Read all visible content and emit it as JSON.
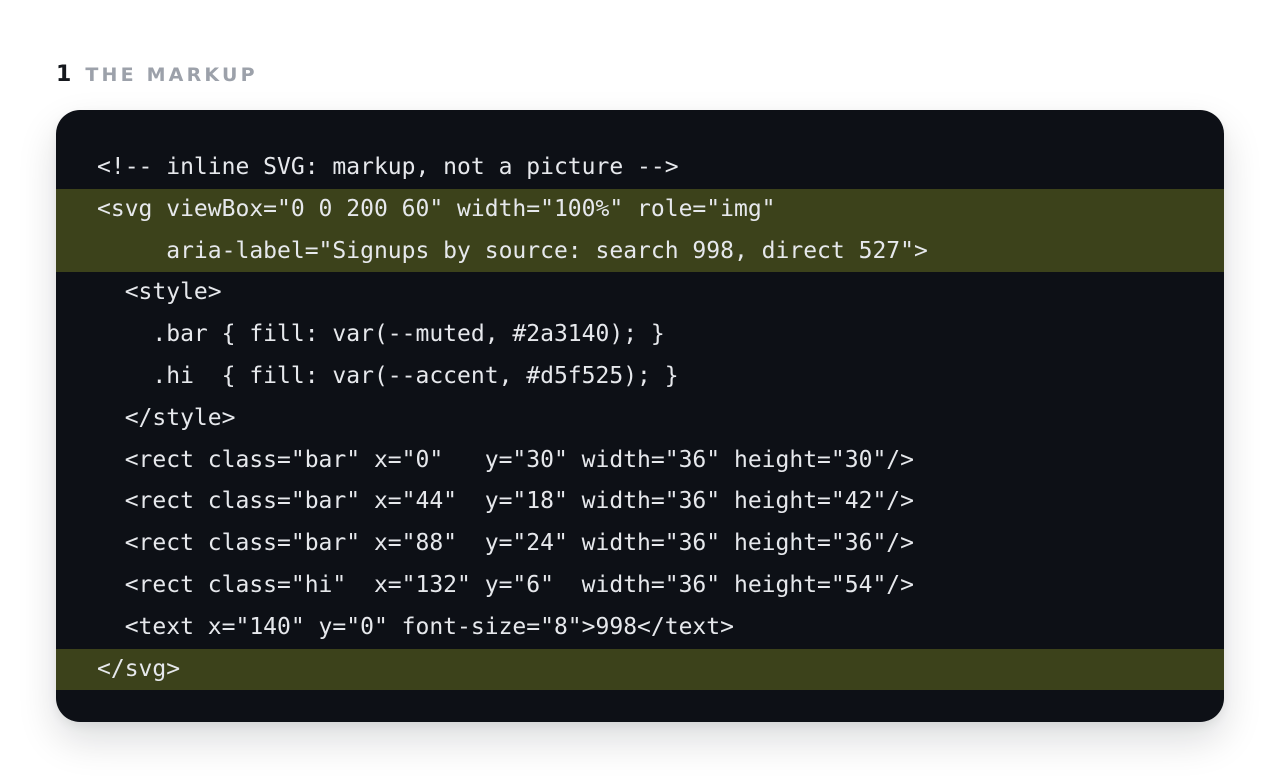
{
  "section": {
    "number": "1",
    "title": "THE MARKUP"
  },
  "code": {
    "lines": [
      {
        "text": "<!-- inline SVG: markup, not a picture -->",
        "highlighted": false
      },
      {
        "text": "<svg viewBox=\"0 0 200 60\" width=\"100%\" role=\"img\"",
        "highlighted": true
      },
      {
        "text": "     aria-label=\"Signups by source: search 998, direct 527\">",
        "highlighted": true
      },
      {
        "text": "  <style>",
        "highlighted": false
      },
      {
        "text": "    .bar { fill: var(--muted, #2a3140); }",
        "highlighted": false
      },
      {
        "text": "    .hi  { fill: var(--accent, #d5f525); }",
        "highlighted": false
      },
      {
        "text": "  </style>",
        "highlighted": false
      },
      {
        "text": "  <rect class=\"bar\" x=\"0\"   y=\"30\" width=\"36\" height=\"30\"/>",
        "highlighted": false
      },
      {
        "text": "  <rect class=\"bar\" x=\"44\"  y=\"18\" width=\"36\" height=\"42\"/>",
        "highlighted": false
      },
      {
        "text": "  <rect class=\"bar\" x=\"88\"  y=\"24\" width=\"36\" height=\"36\"/>",
        "highlighted": false
      },
      {
        "text": "  <rect class=\"hi\"  x=\"132\" y=\"6\"  width=\"36\" height=\"54\"/>",
        "highlighted": false
      },
      {
        "text": "  <text x=\"140\" y=\"0\" font-size=\"8\">998</text>",
        "highlighted": false
      },
      {
        "text": "</svg>",
        "highlighted": true
      }
    ]
  },
  "colors": {
    "card_background": "#0d1016",
    "highlight_background": "#3c421b",
    "code_text": "#e6e8ec",
    "heading_number": "#15181d",
    "heading_title": "#9ca1aa"
  }
}
